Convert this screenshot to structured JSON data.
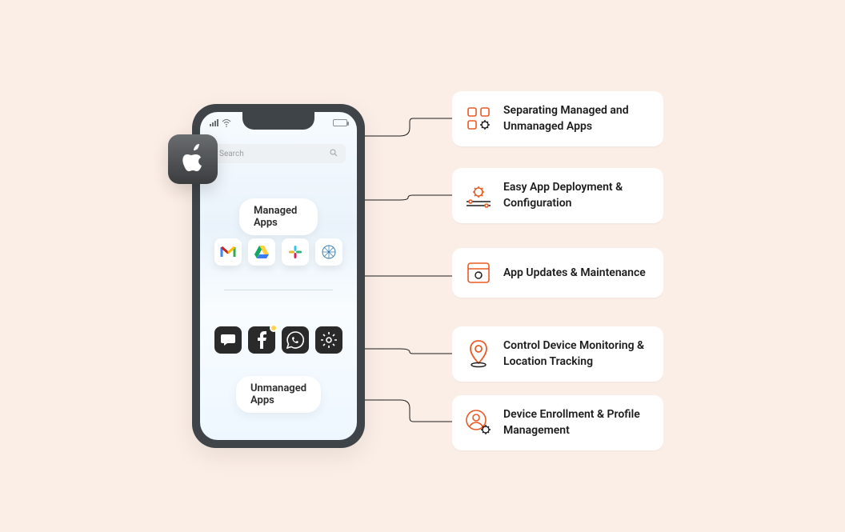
{
  "phone": {
    "search_placeholder": "Search",
    "managed_label": "Managed Apps",
    "unmanaged_label": "Unmanaged Apps",
    "managed_apps": [
      "gmail",
      "gdrive",
      "slack",
      "teams"
    ],
    "unmanaged_apps": [
      "messages",
      "facebook",
      "whatsapp",
      "settings"
    ]
  },
  "badge": {
    "name": "apple"
  },
  "features": [
    {
      "icon": "apps-gear",
      "label": "Separating Managed and Unmanaged Apps"
    },
    {
      "icon": "deploy-gear",
      "label": "Easy App Deployment & Configuration"
    },
    {
      "icon": "updates",
      "label": "App Updates & Maintenance"
    },
    {
      "icon": "location",
      "label": "Control Device Monitoring & Location Tracking"
    },
    {
      "icon": "profile",
      "label": "Device Enrollment & Profile Management"
    }
  ]
}
